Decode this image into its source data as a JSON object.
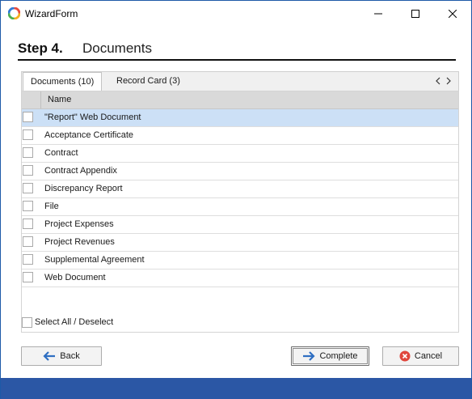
{
  "window": {
    "title": "WizardForm"
  },
  "step": {
    "number": "Step 4.",
    "title": "Documents"
  },
  "tabs": [
    {
      "label": "Documents (10)",
      "active": true
    },
    {
      "label": "Record Card (3)",
      "active": false
    }
  ],
  "grid": {
    "header_name": "Name",
    "rows": [
      {
        "label": "\"Report\" Web Document",
        "checked": false,
        "selected": true
      },
      {
        "label": "Acceptance Certificate",
        "checked": false,
        "selected": false
      },
      {
        "label": "Contract",
        "checked": false,
        "selected": false
      },
      {
        "label": "Contract Appendix",
        "checked": false,
        "selected": false
      },
      {
        "label": "Discrepancy Report",
        "checked": false,
        "selected": false
      },
      {
        "label": "File",
        "checked": false,
        "selected": false
      },
      {
        "label": "Project Expenses",
        "checked": false,
        "selected": false
      },
      {
        "label": "Project Revenues",
        "checked": false,
        "selected": false
      },
      {
        "label": "Supplemental Agreement",
        "checked": false,
        "selected": false
      },
      {
        "label": "Web Document",
        "checked": false,
        "selected": false
      }
    ]
  },
  "select_all": {
    "label": "Select All / Deselect",
    "checked": false
  },
  "buttons": {
    "back": "Back",
    "complete": "Complete",
    "cancel": "Cancel"
  },
  "icons": {
    "app": "app-logo-icon",
    "minimize": "minimize-icon",
    "maximize": "maximize-icon",
    "close": "close-icon",
    "tab_prev": "chevron-left-icon",
    "tab_next": "chevron-right-icon",
    "back": "arrow-left-icon",
    "complete": "arrow-right-icon",
    "cancel": "cancel-circle-icon"
  },
  "colors": {
    "selected_row": "#cce0f6",
    "statusbar": "#2b57a5",
    "arrow": "#2f6fc2",
    "cancel": "#e0463c"
  }
}
